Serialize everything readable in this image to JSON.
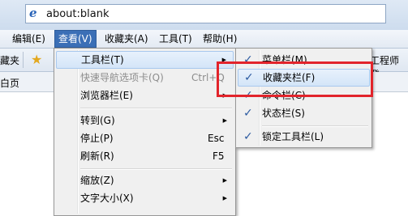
{
  "address_bar": {
    "url": "about:blank",
    "icon": "ie-logo-icon"
  },
  "menubar": {
    "items": [
      {
        "label": "编辑(E)"
      },
      {
        "label": "查看(V)"
      },
      {
        "label": "收藏夹(A)"
      },
      {
        "label": "工具(T)"
      },
      {
        "label": "帮助(H)"
      }
    ]
  },
  "favorites_bar": {
    "left_label": "藏夹",
    "star_icon": "favorites-star-icon",
    "right_label": "工程师登"
  },
  "tab_row": {
    "left_label": "白页"
  },
  "view_menu": {
    "items": [
      {
        "label": "工具栏(T)",
        "shortcut": "",
        "submenu": true,
        "disabled": false
      },
      {
        "label": "快速导航选项卡(Q)",
        "shortcut": "Ctrl+Q",
        "submenu": false,
        "disabled": true
      },
      {
        "label": "浏览器栏(E)",
        "shortcut": "",
        "submenu": true,
        "disabled": false
      },
      {
        "label": "转到(G)",
        "shortcut": "",
        "submenu": true,
        "disabled": false
      },
      {
        "label": "停止(P)",
        "shortcut": "Esc",
        "submenu": false,
        "disabled": false
      },
      {
        "label": "刷新(R)",
        "shortcut": "F5",
        "submenu": false,
        "disabled": false
      },
      {
        "label": "缩放(Z)",
        "shortcut": "",
        "submenu": true,
        "disabled": false
      },
      {
        "label": "文字大小(X)",
        "shortcut": "",
        "submenu": true,
        "disabled": false
      }
    ]
  },
  "toolbars_submenu": {
    "items": [
      {
        "label": "菜单栏(M)",
        "checked": true
      },
      {
        "label": "收藏夹栏(F)",
        "checked": true
      },
      {
        "label": "命令栏(C)",
        "checked": true
      },
      {
        "label": "状态栏(S)",
        "checked": true
      },
      {
        "label": "锁定工具栏(L)",
        "checked": true
      }
    ]
  },
  "colors": {
    "menu_highlight": "#3b6fb6",
    "annotation_box": "#e2242b",
    "check": "#2b5aa0"
  }
}
